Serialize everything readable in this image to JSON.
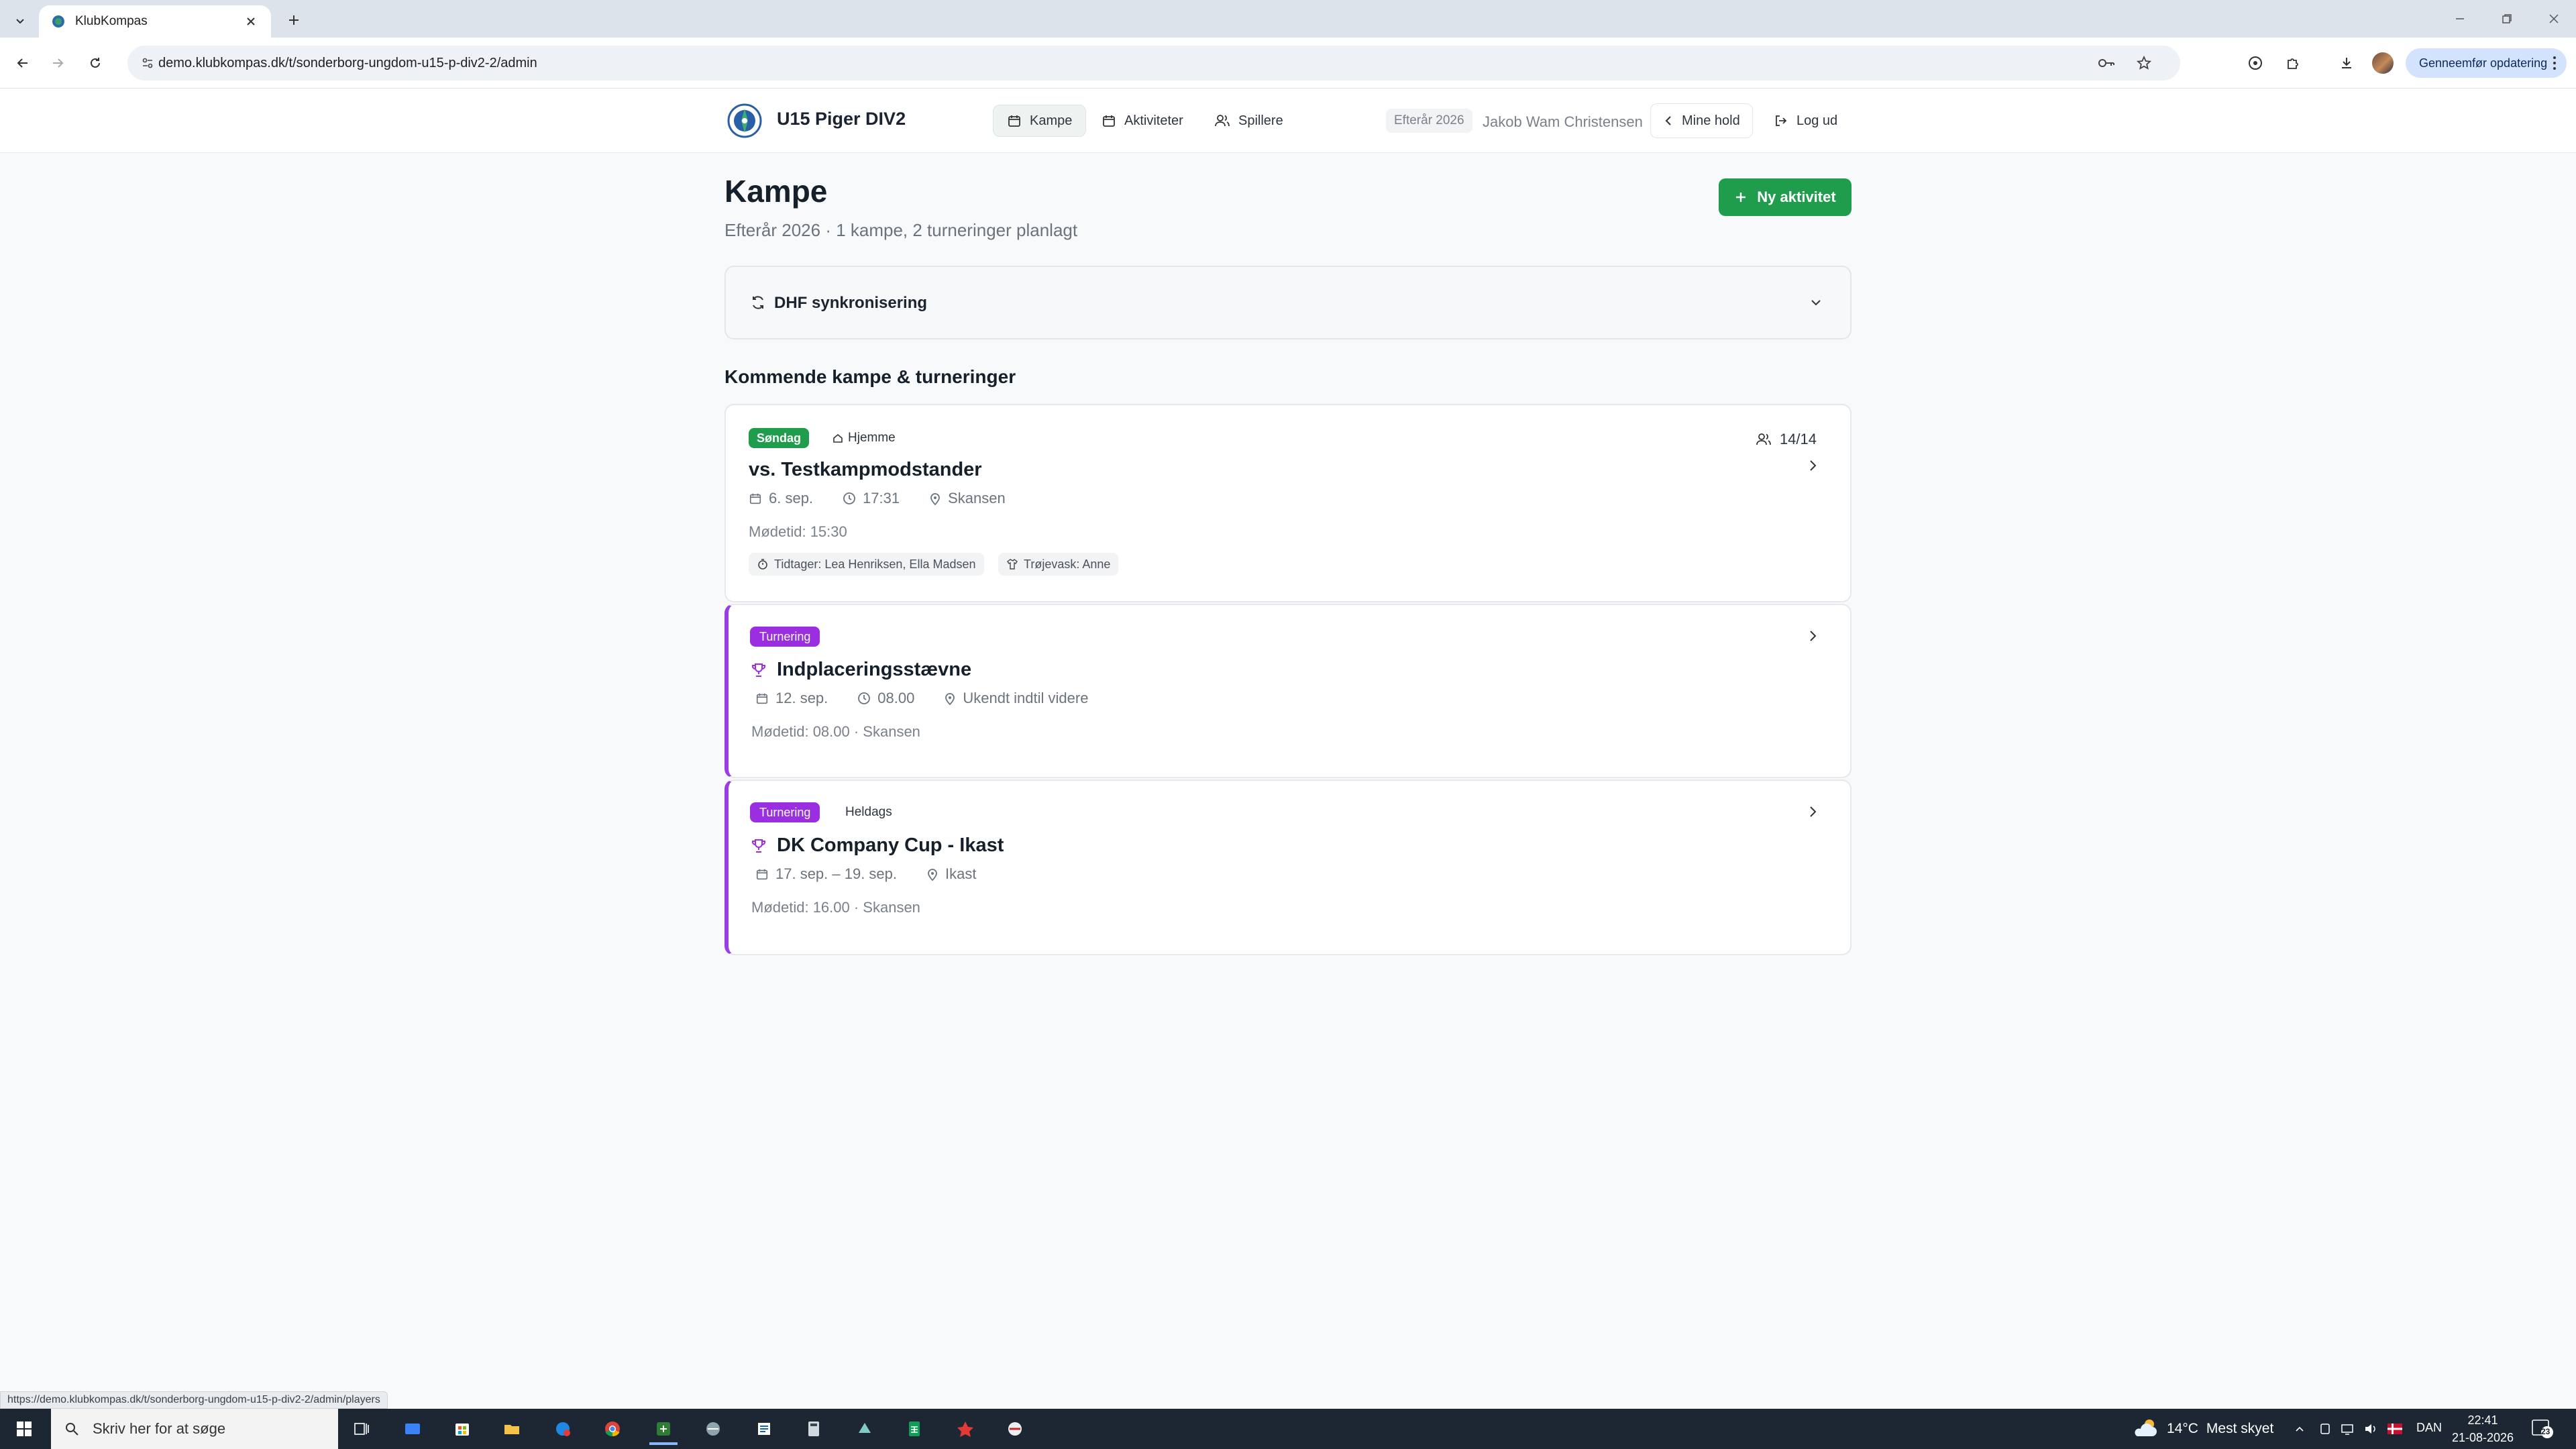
{
  "browser": {
    "tab_title": "KlubKompas",
    "url": "demo.klubkompas.dk/t/sonderborg-ungdom-u15-p-div2-2/admin",
    "update_label": "Genneemfør opdatering"
  },
  "header": {
    "team_name": "U15 Piger DIV2",
    "nav": [
      {
        "label": "Kampe",
        "icon": "calendar-icon",
        "active": true
      },
      {
        "label": "Aktiviteter",
        "icon": "calendar-icon",
        "active": false
      },
      {
        "label": "Spillere",
        "icon": "users-icon",
        "active": false
      }
    ],
    "season": "Efterår 2026",
    "user": "Jakob Wam Christensen",
    "my_teams": "Mine hold",
    "logout": "Log ud"
  },
  "page": {
    "title": "Kampe",
    "subtitle": "Efterår 2026 · 1 kampe, 2 turneringer planlagt",
    "new_button": "Ny aktivitet",
    "sync_label": "DHF synkronisering",
    "section_title": "Kommende kampe & turneringer"
  },
  "events": [
    {
      "type": "match",
      "day_badge": "Søndag",
      "venue_tag": "Hjemme",
      "title": "vs. Testkampmodstander",
      "date": "6. sep.",
      "time": "17:31",
      "location": "Skansen",
      "meeting": "Mødetid: 15:30",
      "players": "14/14",
      "pills": [
        {
          "icon": "stopwatch-icon",
          "label": "Tidtager: Lea Henriksen, Ella Madsen"
        },
        {
          "icon": "shirt-icon",
          "label": "Trøjevask: Anne"
        }
      ]
    },
    {
      "type": "tournament",
      "badge": "Turnering",
      "title": "Indplaceringsstævne",
      "date": "12. sep.",
      "time": "08.00",
      "location": "Ukendt indtil videre",
      "meeting": "Mødetid: 08.00 · Skansen"
    },
    {
      "type": "tournament",
      "badge": "Turnering",
      "extra_tag": "Heldags",
      "title": "DK Company Cup - Ikast",
      "date": "17. sep. – 19. sep.",
      "location": "Ikast",
      "meeting": "Mødetid: 16.00 · Skansen"
    }
  ],
  "status_url": "https://demo.klubkompas.dk/t/sonderborg-ungdom-u15-p-div2-2/admin/players",
  "taskbar": {
    "search_placeholder": "Skriv her for at søge",
    "weather_temp": "14°C",
    "weather_desc": "Mest skyet",
    "lang": "DAN",
    "time": "22:41",
    "date": "21-08-2026",
    "notification_count": "23"
  },
  "colors": {
    "brand_green": "#1f9d4c",
    "tournament_purple": "#9b2ee0"
  }
}
